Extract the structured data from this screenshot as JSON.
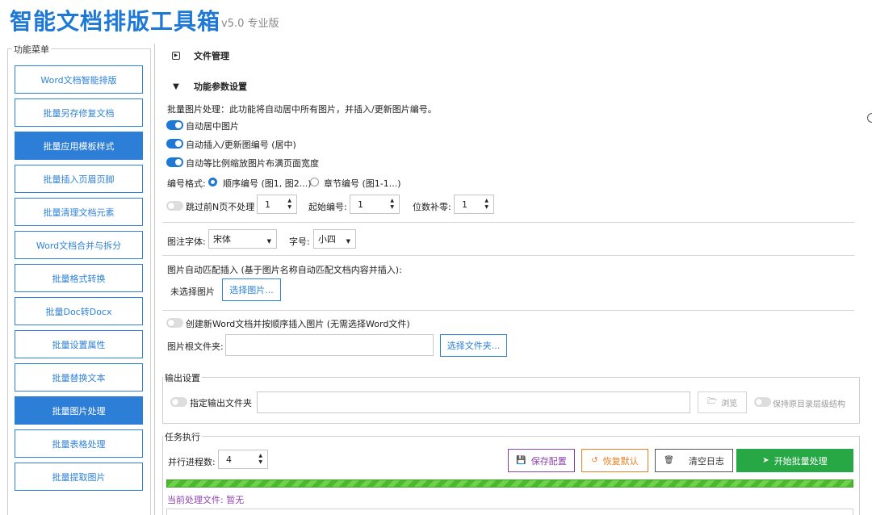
{
  "app": {
    "title": "智能文档排版工具箱",
    "version": "v5.0 专业版"
  },
  "sidebar": {
    "legend": "功能菜单",
    "items": [
      {
        "label": "Word文档智能排版",
        "active": false
      },
      {
        "label": "批量另存修复文档",
        "active": false
      },
      {
        "label": "批量应用模板样式",
        "active": true
      },
      {
        "label": "批量插入页眉页脚",
        "active": false
      },
      {
        "label": "批量清理文档元素",
        "active": false
      },
      {
        "label": "Word文档合并与拆分",
        "active": false
      },
      {
        "label": "批量格式转换",
        "active": false
      },
      {
        "label": "批量Doc转Docx",
        "active": false
      },
      {
        "label": "批量设置属性",
        "active": false
      },
      {
        "label": "批量替换文本",
        "active": false
      },
      {
        "label": "批量图片处理",
        "active": true
      },
      {
        "label": "批量表格处理",
        "active": false
      },
      {
        "label": "批量提取图片",
        "active": false
      }
    ]
  },
  "file_section": {
    "title": "文件管理",
    "expanded": false
  },
  "param_section": {
    "title": "功能参数设置",
    "expanded": true,
    "description": "批量图片处理：此功能将自动居中所有图片，并插入/更新图片编号。",
    "toggles": [
      {
        "label": "自动居中图片",
        "on": true
      },
      {
        "label": "自动插入/更新图编号 (居中)",
        "on": true
      },
      {
        "label": "自动等比例缩放图片布满页面宽度",
        "on": true
      }
    ],
    "numbering": {
      "label": "编号格式:",
      "options": [
        {
          "label": "顺序编号 (图1, 图2...)",
          "selected": true
        },
        {
          "label": "章节编号 (图1-1...)",
          "selected": false
        }
      ]
    },
    "skip": {
      "label": "跳过前N页不处理",
      "on": false,
      "value": "1"
    },
    "start": {
      "label": "起始编号:",
      "value": "1"
    },
    "padding": {
      "label": "位数补零:",
      "value": "1"
    },
    "caption_font": {
      "label": "图注字体:",
      "value": "宋体"
    },
    "font_size": {
      "label": "字号:",
      "value": "小四"
    },
    "auto_match": {
      "label": "图片自动匹配插入 (基于图片名称自动匹配文档内容并插入):",
      "status": "未选择图片",
      "button": "选择图片..."
    },
    "create_doc": {
      "label": "创建新Word文档并按顺序插入图片 (无需选择Word文件)",
      "on": false
    },
    "root_folder": {
      "label": "图片根文件夹:",
      "value": "",
      "button": "选择文件夹..."
    }
  },
  "output": {
    "legend": "输出设置",
    "toggle_label": "指定输出文件夹",
    "toggle_on": false,
    "path": "",
    "browse": "浏览",
    "keep_structure": "保持原目录层级结构",
    "keep_on": false
  },
  "task": {
    "legend": "任务执行",
    "threads_label": "并行进程数:",
    "threads": "4",
    "buttons": {
      "save": "保存配置",
      "reset": "恢复默认",
      "clear": "清空日志",
      "start": "开始批量处理"
    },
    "progress": 1.0,
    "current_label": "当前处理文件: 暂无"
  },
  "colors": {
    "primary": "#1e78d6",
    "save": "#8e44ad",
    "reset": "#e67e22",
    "start": "#28a745",
    "current_text": "#8e44ad"
  }
}
